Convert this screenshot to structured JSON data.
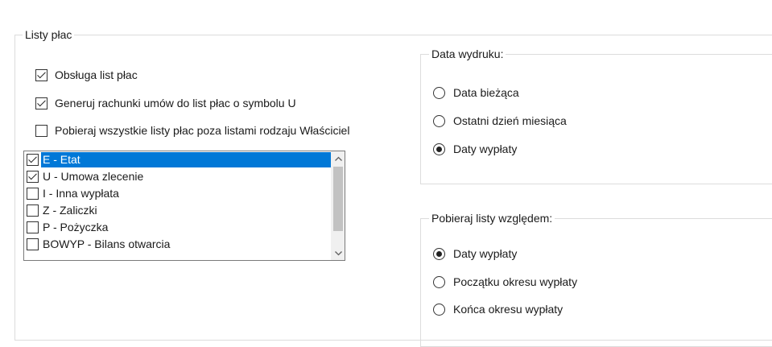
{
  "payroll_group": {
    "title": "Listy płac",
    "options": [
      {
        "label": "Obsługa list płac",
        "checked": true
      },
      {
        "label": "Generuj rachunki umów do list płac o symbolu U",
        "checked": true
      },
      {
        "label": "Pobieraj wszystkie listy płac poza listami rodzaju Właściciel",
        "checked": false
      }
    ],
    "list": [
      {
        "label": "E - Etat",
        "checked": true,
        "selected": true
      },
      {
        "label": "U - Umowa zlecenie",
        "checked": true,
        "selected": false
      },
      {
        "label": "I - Inna wypłata",
        "checked": false,
        "selected": false
      },
      {
        "label": "Z - Zaliczki",
        "checked": false,
        "selected": false
      },
      {
        "label": "P - Pożyczka",
        "checked": false,
        "selected": false
      },
      {
        "label": "BOWYP - Bilans otwarcia",
        "checked": false,
        "selected": false
      }
    ]
  },
  "print_date_group": {
    "title": "Data wydruku:",
    "options": [
      {
        "label": "Data bieżąca",
        "checked": false
      },
      {
        "label": "Ostatni dzień miesiąca",
        "checked": false
      },
      {
        "label": "Daty wypłaty",
        "checked": true
      }
    ]
  },
  "fetch_group": {
    "title": "Pobieraj listy względem:",
    "options": [
      {
        "label": "Daty wypłaty",
        "checked": true
      },
      {
        "label": "Początku okresu wypłaty",
        "checked": false
      },
      {
        "label": "Końca okresu wypłaty",
        "checked": false
      }
    ]
  },
  "colors": {
    "selection": "#0078d7",
    "group_border": "#dcdcdc"
  },
  "icons": {
    "scroll_up": "chevron-up-icon",
    "scroll_down": "chevron-down-icon"
  }
}
